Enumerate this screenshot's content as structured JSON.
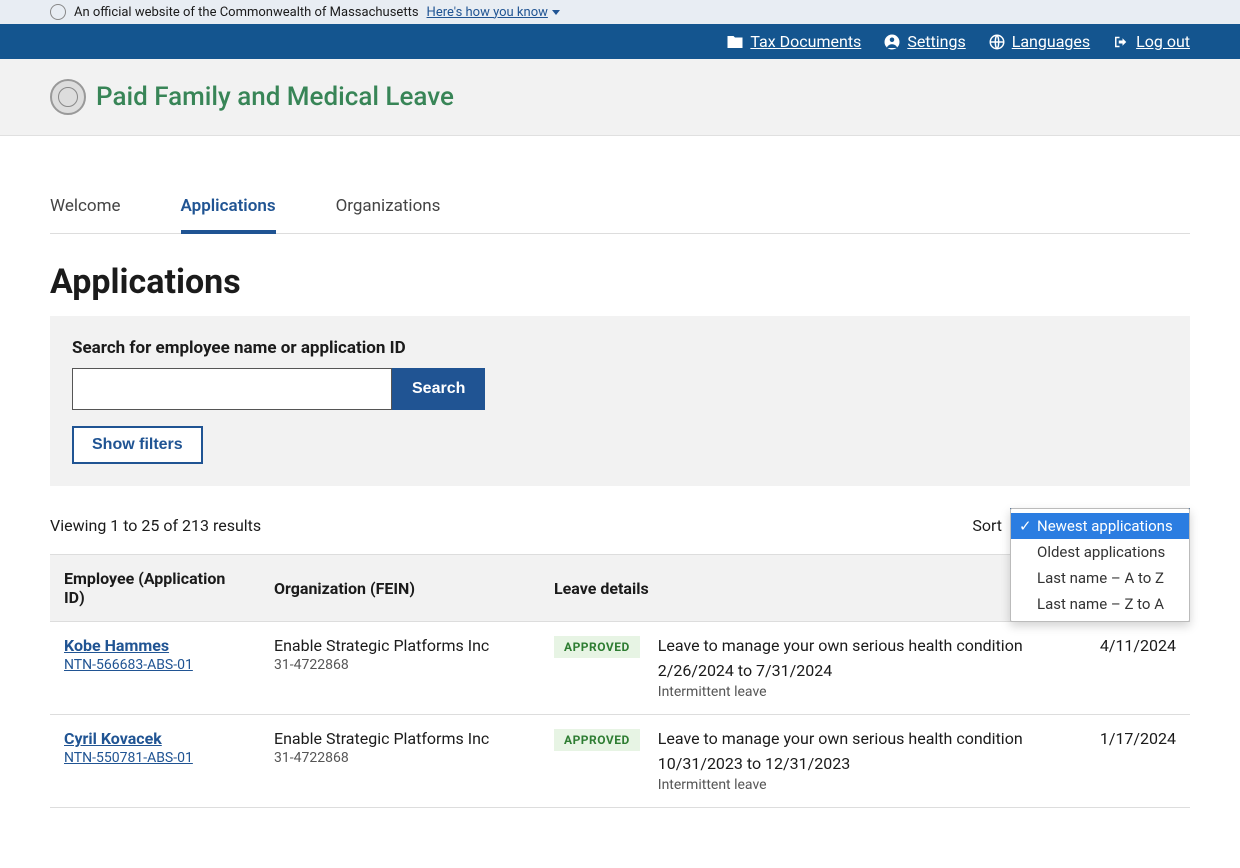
{
  "official_bar": {
    "text": "An official website of the Commonwealth of Massachusetts",
    "link": "Here's how you know"
  },
  "top_nav": {
    "tax": "Tax Documents",
    "settings": "Settings",
    "languages": "Languages",
    "logout": "Log out"
  },
  "app_title": "Paid Family and Medical Leave",
  "tabs": {
    "welcome": "Welcome",
    "applications": "Applications",
    "organizations": "Organizations"
  },
  "page": {
    "title": "Applications"
  },
  "search": {
    "label": "Search for employee name or application ID",
    "button": "Search",
    "filters_button": "Show filters"
  },
  "results": {
    "count_text": "Viewing 1 to 25 of 213 results",
    "sort_label": "Sort",
    "sort_options": [
      "Newest applications",
      "Oldest applications",
      "Last name – A to Z",
      "Last name – Z to A"
    ]
  },
  "table": {
    "headers": {
      "employee": "Employee (Application ID)",
      "organization": "Organization (FEIN)",
      "leave": "Leave details"
    },
    "rows": [
      {
        "name": "Kobe Hammes",
        "app_id": "NTN-566683-ABS-01",
        "org": "Enable Strategic Platforms Inc",
        "fein": "31-4722868",
        "status": "APPROVED",
        "leave_title": "Leave to manage your own serious health condition",
        "dates": "2/26/2024 to 7/31/2024",
        "type": "Intermittent leave",
        "submitted": "4/11/2024"
      },
      {
        "name": "Cyril Kovacek",
        "app_id": "NTN-550781-ABS-01",
        "org": "Enable Strategic Platforms Inc",
        "fein": "31-4722868",
        "status": "APPROVED",
        "leave_title": "Leave to manage your own serious health condition",
        "dates": "10/31/2023 to 12/31/2023",
        "type": "Intermittent leave",
        "submitted": "1/17/2024"
      }
    ]
  }
}
